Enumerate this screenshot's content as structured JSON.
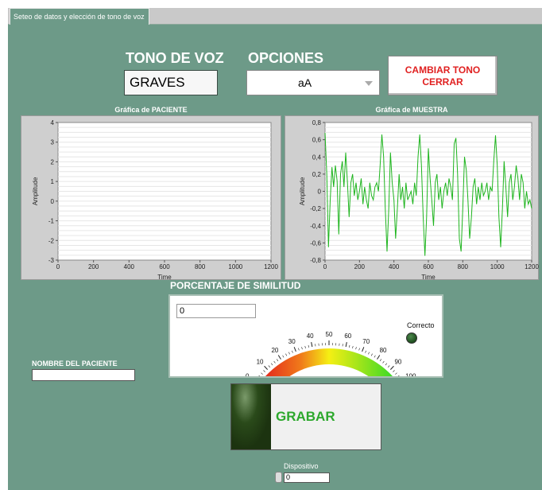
{
  "tab": {
    "label": "Seteo de datos y elección de tono de voz"
  },
  "header": {
    "tono_title": "TONO DE VOZ",
    "tono_value": "GRAVES",
    "opciones_title": "OPCIONES",
    "opciones_value": "aA",
    "button_line1": "CAMBIAR TONO",
    "button_line2": "CERRAR"
  },
  "chart_data": [
    {
      "type": "line",
      "title": "Gráfica de PACIENTE",
      "xlabel": "Time",
      "ylabel": "Amplitude",
      "xlim": [
        0,
        1200
      ],
      "ylim": [
        -3,
        4
      ],
      "xticks": [
        "0",
        "200",
        "400",
        "600",
        "800",
        "1000",
        "1200"
      ],
      "yticks": [
        "4",
        "3",
        "2",
        "1",
        "0",
        "-1",
        "-2",
        "-3"
      ],
      "series": []
    },
    {
      "type": "line",
      "title": "Gráfica de MUESTRA",
      "xlabel": "Time",
      "ylabel": "Amplitude",
      "xlim": [
        0,
        1200
      ],
      "ylim": [
        -0.8,
        0.8
      ],
      "xticks": [
        "0",
        "200",
        "400",
        "600",
        "800",
        "1000",
        "1200"
      ],
      "yticks": [
        "0,8",
        "0,6",
        "0,4",
        "0,2",
        "0",
        "-0,2",
        "-0,4",
        "-0,6",
        "-0,8"
      ],
      "line_color": "#1fb51f",
      "series": [
        {
          "x": [
            0,
            10,
            20,
            30,
            40,
            50,
            60,
            70,
            80,
            90,
            100,
            110,
            120,
            130,
            140,
            150,
            160,
            170,
            180,
            190,
            200,
            210,
            220,
            230,
            240,
            250,
            260,
            270,
            280,
            290,
            300,
            310,
            320,
            330,
            340,
            350,
            360,
            370,
            380,
            390,
            400,
            410,
            420,
            430,
            440,
            450,
            460,
            470,
            480,
            490,
            500,
            510,
            520,
            530,
            540,
            550,
            560,
            570,
            580,
            590,
            600,
            610,
            620,
            630,
            640,
            650,
            660,
            670,
            680,
            690,
            700,
            710,
            720,
            730,
            740,
            750,
            760,
            770,
            780,
            790,
            800,
            810,
            820,
            830,
            840,
            850,
            860,
            870,
            880,
            890,
            900,
            910,
            920,
            930,
            940,
            950,
            960,
            970,
            980,
            990,
            1000,
            1010,
            1020,
            1030,
            1040,
            1050,
            1060,
            1070,
            1080,
            1090,
            1100,
            1110,
            1120,
            1130,
            1140,
            1150,
            1160,
            1170,
            1180,
            1190,
            1200
          ],
          "y": [
            0.68,
            0.2,
            -0.65,
            -0.1,
            0.28,
            0.05,
            0.3,
            0.12,
            -0.5,
            0.2,
            0.35,
            0.05,
            0.45,
            0.1,
            -0.3,
            0.1,
            0.2,
            -0.05,
            0.1,
            -0.1,
            0.0,
            0.15,
            -0.15,
            0.05,
            -0.1,
            -0.2,
            0.1,
            -0.05,
            -0.1,
            0.05,
            0.1,
            0.0,
            0.3,
            0.66,
            0.4,
            -0.2,
            -0.7,
            -0.2,
            0.45,
            0.1,
            -0.1,
            -0.55,
            -0.2,
            0.2,
            -0.1,
            0.05,
            -0.2,
            0.1,
            -0.1,
            -0.05,
            0.0,
            -0.15,
            0.1,
            -0.05,
            0.4,
            0.66,
            0.3,
            -0.3,
            -0.75,
            -0.3,
            0.5,
            0.15,
            -0.1,
            -0.4,
            0.1,
            0.2,
            -0.1,
            0.05,
            -0.2,
            0.0,
            0.1,
            -0.05,
            0.15,
            0.05,
            -0.1,
            0.55,
            0.62,
            0.2,
            -0.55,
            -0.7,
            -0.2,
            0.4,
            0.25,
            -0.1,
            -0.55,
            -0.3,
            0.05,
            0.15,
            -0.15,
            0.05,
            -0.1,
            0.1,
            -0.05,
            0.0,
            0.1,
            -0.1,
            0.05,
            0.0,
            0.35,
            0.65,
            0.3,
            -0.3,
            -0.65,
            -0.2,
            0.35,
            0.05,
            -0.3,
            0.1,
            0.2,
            -0.1,
            0.05,
            0.3,
            0.15,
            -0.1,
            0.2,
            0.1,
            -0.2,
            0.0,
            -0.15,
            -0.1,
            -0.2
          ]
        }
      ]
    }
  ],
  "gauge": {
    "title": "PORCENTAJE DE SIMILITUD",
    "value": 0,
    "value_display": "0",
    "min": 0,
    "max": 100,
    "tick_labels": [
      "0",
      "10",
      "20",
      "30",
      "40",
      "50",
      "60",
      "70",
      "80",
      "90",
      "100"
    ],
    "led_label": "Correcto",
    "led_on": false
  },
  "patient": {
    "label": "NOMBRE DEL PACIENTE",
    "value": ""
  },
  "record": {
    "label": "GRABAR"
  },
  "device": {
    "label": "Dispositivo",
    "value": "0"
  },
  "colors": {
    "panel_bg": "#6d9a88",
    "record_text": "#2ca82c",
    "button_text": "#e02020",
    "led_off": "#1e4d1e"
  }
}
